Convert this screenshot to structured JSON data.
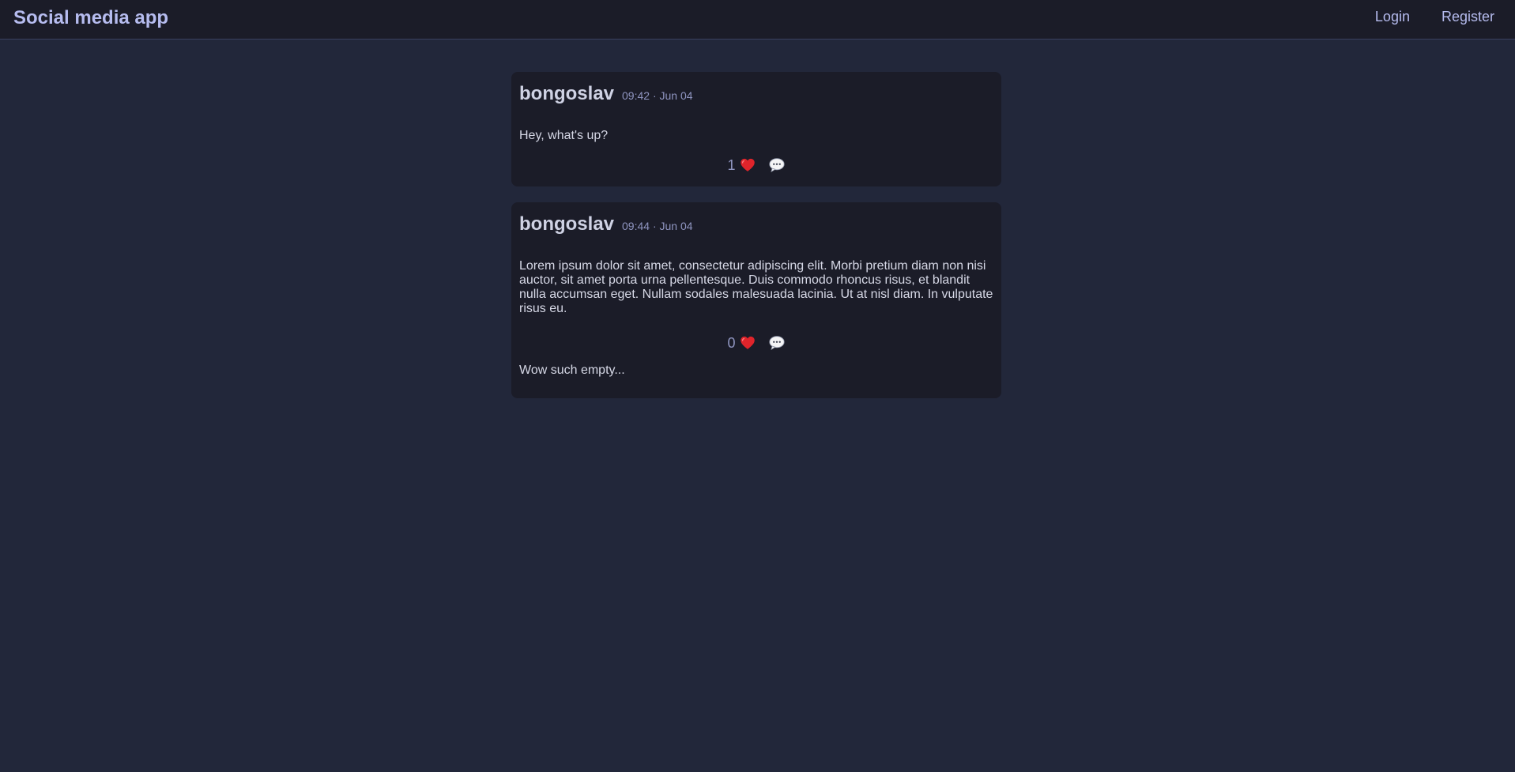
{
  "navbar": {
    "brand": "Social media app",
    "links": [
      {
        "label": "Login"
      },
      {
        "label": "Register"
      }
    ]
  },
  "posts": [
    {
      "author": "bongoslav",
      "timestamp": "09:42 · Jun 04",
      "body": "Hey, what's up?",
      "likes": "1",
      "like_icon": "heart-icon",
      "comment_icon": "speech-bubble-icon"
    },
    {
      "author": "bongoslav",
      "timestamp": "09:44 · Jun 04",
      "body": "Lorem ipsum dolor sit amet, consectetur adipiscing elit. Morbi pretium diam non nisi auctor, sit amet porta urna pellentesque. Duis commodo rhoncus risus, et blandit nulla accumsan eget. Nullam sodales malesuada lacinia. Ut at nisl diam. In vulputate risus eu.",
      "likes": "0",
      "like_icon": "heart-icon",
      "comment_icon": "speech-bubble-icon",
      "comments_empty": "Wow such empty..."
    }
  ],
  "colors": {
    "background": "#22273a",
    "navbar": "#1b1c28",
    "card": "#1b1c28",
    "accent": "#b6bcef",
    "heart": "#e0242b"
  }
}
